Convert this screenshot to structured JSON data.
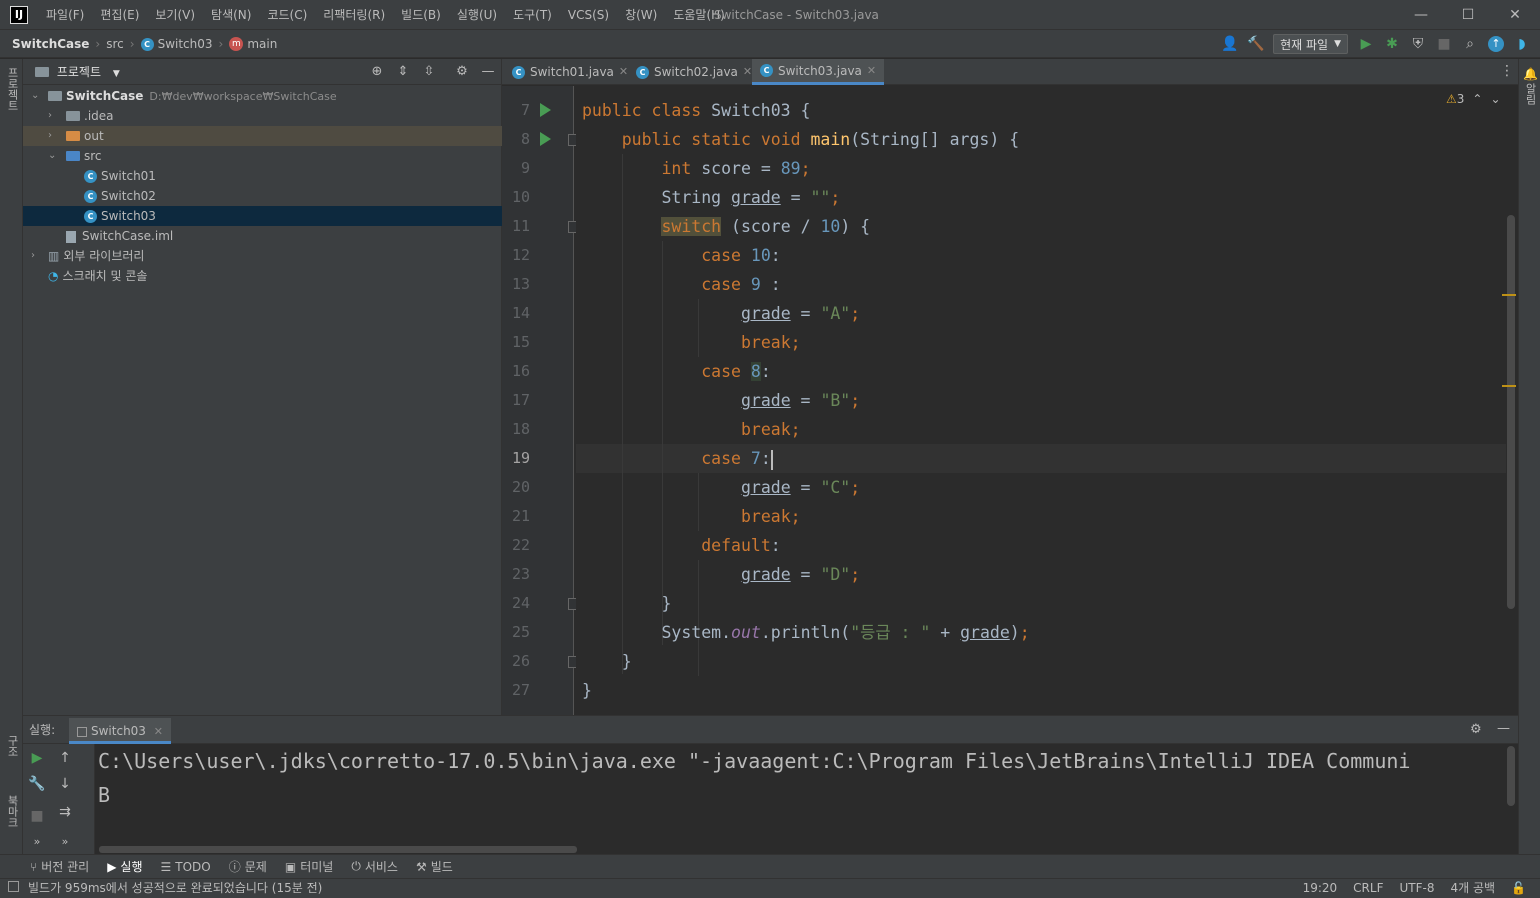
{
  "window": {
    "app_logo": "IJ",
    "title": "SwitchCase - Switch03.java",
    "menu": [
      "파일(F)",
      "편집(E)",
      "보기(V)",
      "탐색(N)",
      "코드(C)",
      "리팩터링(R)",
      "빌드(B)",
      "실행(U)",
      "도구(T)",
      "VCS(S)",
      "창(W)",
      "도움말(H)"
    ],
    "controls": {
      "minimize": "—",
      "maximize": "☐",
      "close": "✕"
    }
  },
  "breadcrumb": {
    "project": "SwitchCase",
    "folder": "src",
    "class": "Switch03",
    "method": "main",
    "class_icon": "C",
    "method_icon": "m"
  },
  "toolbar": {
    "run_config": "현재 파일"
  },
  "left_strip": {
    "project_label": "프로젝트",
    "structure_label": "구조",
    "bookmarks_label": "북마크"
  },
  "right_strip": {
    "notifications_label": "알림"
  },
  "project_panel": {
    "title": "프로젝트",
    "tree": [
      {
        "label": "SwitchCase",
        "path": "D:₩dev₩workspace₩SwitchCase",
        "arrow": "⌄",
        "icon": "project-folder-icon"
      },
      {
        "label": ".idea",
        "arrow": "›",
        "icon": "folder-icon"
      },
      {
        "label": "out",
        "arrow": "›",
        "icon": "folder-orange-icon"
      },
      {
        "label": "src",
        "arrow": "⌄",
        "icon": "folder-blue-icon"
      },
      {
        "label": "Switch01",
        "icon": "java-class-icon"
      },
      {
        "label": "Switch02",
        "icon": "java-class-icon"
      },
      {
        "label": "Switch03",
        "icon": "java-class-icon"
      },
      {
        "label": "SwitchCase.iml",
        "icon": "iml-file-icon"
      },
      {
        "label": "외부 라이브러리",
        "arrow": "›",
        "icon": "library-icon"
      },
      {
        "label": "스크래치 및 콘솔",
        "icon": "scratch-icon"
      }
    ]
  },
  "editor": {
    "tabs": [
      {
        "label": "Switch01.java",
        "close": "✕"
      },
      {
        "label": "Switch02.java",
        "close": "✕"
      },
      {
        "label": "Switch03.java",
        "close": "✕"
      }
    ],
    "warnings": {
      "count": "3"
    },
    "line_numbers": [
      "7",
      "8",
      "9",
      "10",
      "11",
      "12",
      "13",
      "14",
      "15",
      "16",
      "17",
      "18",
      "19",
      "20",
      "21",
      "22",
      "23",
      "24",
      "25",
      "26",
      "27"
    ]
  },
  "run_panel": {
    "title": "실행:",
    "tab": "Switch03",
    "console": [
      "C:\\Users\\user\\.jdks\\corretto-17.0.5\\bin\\java.exe \"-javaagent:C:\\Program Files\\JetBrains\\IntelliJ IDEA Communi",
      "B"
    ]
  },
  "bottom_tabs": [
    "버전 관리",
    "실행",
    "TODO",
    "문제",
    "터미널",
    "서비스",
    "빌드"
  ],
  "status": {
    "message": "빌드가 959ms에서 성공적으로 완료되었습니다 (15분 전)",
    "position": "19:20",
    "line_sep": "CRLF",
    "encoding": "UTF-8",
    "indent": "4개 공백"
  },
  "colors": {
    "keyword": "#cc7832",
    "number": "#6897bb",
    "string": "#6a8759",
    "function": "#ffc66d",
    "field": "#9876aa",
    "accent": "#4a88c7",
    "run_green": "#499c54"
  }
}
